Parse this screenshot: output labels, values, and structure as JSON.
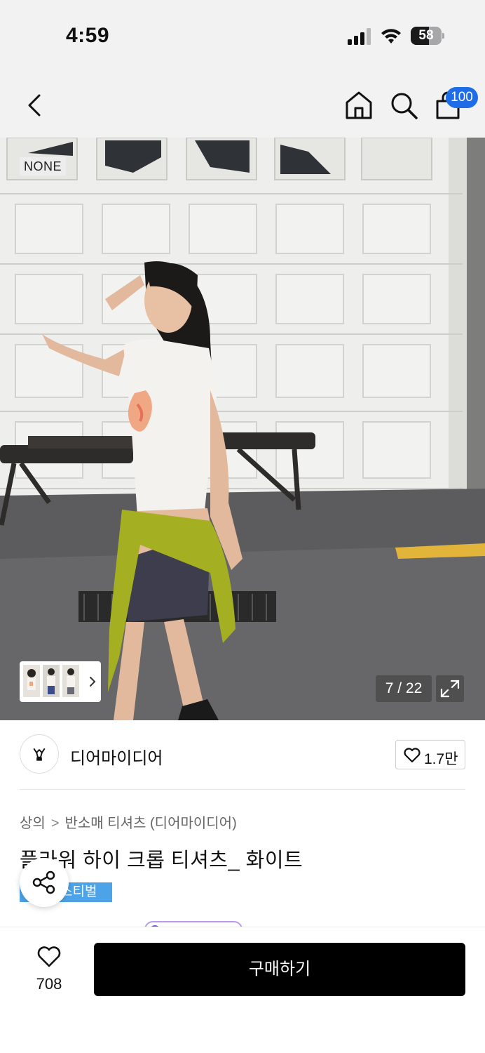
{
  "status_bar": {
    "time": "4:59",
    "battery_level": "58",
    "battery_fraction": 0.58,
    "signal_bars": "3 of 4",
    "icons": [
      "cellular-signal-icon",
      "wifi-icon",
      "battery-icon"
    ]
  },
  "nav": {
    "back_icon": "chevron-left-icon",
    "home_icon": "home-icon",
    "search_icon": "search-icon",
    "cart_icon": "shopping-bag-icon",
    "cart_badge": "100",
    "badge_color": "#1f6de6"
  },
  "hero": {
    "brand_tag": "NONE",
    "image_counter": "7 / 22",
    "expand_icon": "expand-arrows-icon",
    "thumbnail_arrow_icon": "chevron-right-icon"
  },
  "brand": {
    "name": "디어마이디어",
    "like_count": "1.7만",
    "like_icon": "heart-outline-icon"
  },
  "product": {
    "breadcrumb": [
      "상의",
      "반소매 티셔츠 (디어마이디어)"
    ],
    "breadcrumb_separator": ">",
    "title": "플라워 하이 크롭 티셔츠_ 화이트",
    "festival_badge": "스티벌",
    "badge_color": "#4da3e8",
    "share_icon": "share-icon"
  },
  "bottom_bar": {
    "wish_count": "708",
    "wish_icon": "heart-outline-icon",
    "buy_label": "구매하기"
  }
}
